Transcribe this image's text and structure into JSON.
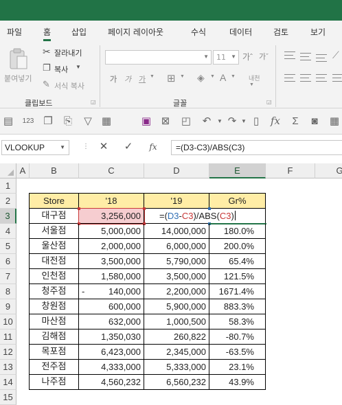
{
  "ribbon_tabs": [
    "파일",
    "홈",
    "삽입",
    "페이지 레이아웃",
    "수식",
    "데이터",
    "검토",
    "보기"
  ],
  "active_tab": "홈",
  "clipboard": {
    "paste_label": "붙여넣기",
    "cut_label": "잘라내기",
    "copy_label": "복사",
    "format_painter_label": "서식 복사",
    "group_label": "클립보드"
  },
  "font": {
    "font_name": "",
    "font_size": "11",
    "group_label": "글꼴",
    "bold_glyph": "가",
    "italic_glyph": "가",
    "underline_glyph": "가",
    "phonetic_label": "내천"
  },
  "formula_bar": {
    "name_box": "VLOOKUP",
    "formula": "=(D3-C3)/ABS(C3)",
    "fx_label": "fx"
  },
  "columns": [
    "A",
    "B",
    "C",
    "D",
    "E",
    "F",
    "G"
  ],
  "rows": [
    "1",
    "2",
    "3",
    "4",
    "5",
    "6",
    "7",
    "8",
    "9",
    "10",
    "11",
    "12",
    "13",
    "14",
    "15"
  ],
  "table": {
    "headers": [
      "Store",
      "'18",
      "'19",
      "Gr%"
    ],
    "rows": [
      {
        "store": "대구점",
        "y18": "3,256,000",
        "y19": "",
        "gr": ""
      },
      {
        "store": "서울점",
        "y18": "5,000,000",
        "y19": "14,000,000",
        "gr": "180.0%"
      },
      {
        "store": "울산점",
        "y18": "2,000,000",
        "y19": "6,000,000",
        "gr": "200.0%"
      },
      {
        "store": "대전점",
        "y18": "3,500,000",
        "y19": "5,790,000",
        "gr": "65.4%"
      },
      {
        "store": "인천점",
        "y18": "1,580,000",
        "y19": "3,500,000",
        "gr": "121.5%"
      },
      {
        "store": "청주점",
        "y18": "140,000",
        "y18_prefix": "-",
        "y19": "2,200,000",
        "gr": "1671.4%"
      },
      {
        "store": "창원점",
        "y18": "600,000",
        "y19": "5,900,000",
        "gr": "883.3%"
      },
      {
        "store": "마산점",
        "y18": "632,000",
        "y19": "1,000,500",
        "gr": "58.3%"
      },
      {
        "store": "김해점",
        "y18": "1,350,030",
        "y19": "260,822",
        "gr": "-80.7%"
      },
      {
        "store": "목포점",
        "y18": "6,423,000",
        "y19": "2,345,000",
        "gr": "-63.5%"
      },
      {
        "store": "전주점",
        "y18": "4,333,000",
        "y19": "5,333,000",
        "gr": "23.1%"
      },
      {
        "store": "나주점",
        "y18": "4,560,232",
        "y19": "6,560,232",
        "gr": "43.9%"
      }
    ]
  },
  "editing_cell": {
    "ref": "E3",
    "parts": [
      "=(",
      "D3",
      "-",
      "C3",
      ")/ABS(",
      "C3",
      ")"
    ]
  },
  "colors": {
    "accent": "#217346",
    "header_fill": "#ffeda6",
    "ref_blue": "#2f6fb5",
    "ref_red": "#c83737",
    "c3_fill": "#f6cdd0"
  }
}
